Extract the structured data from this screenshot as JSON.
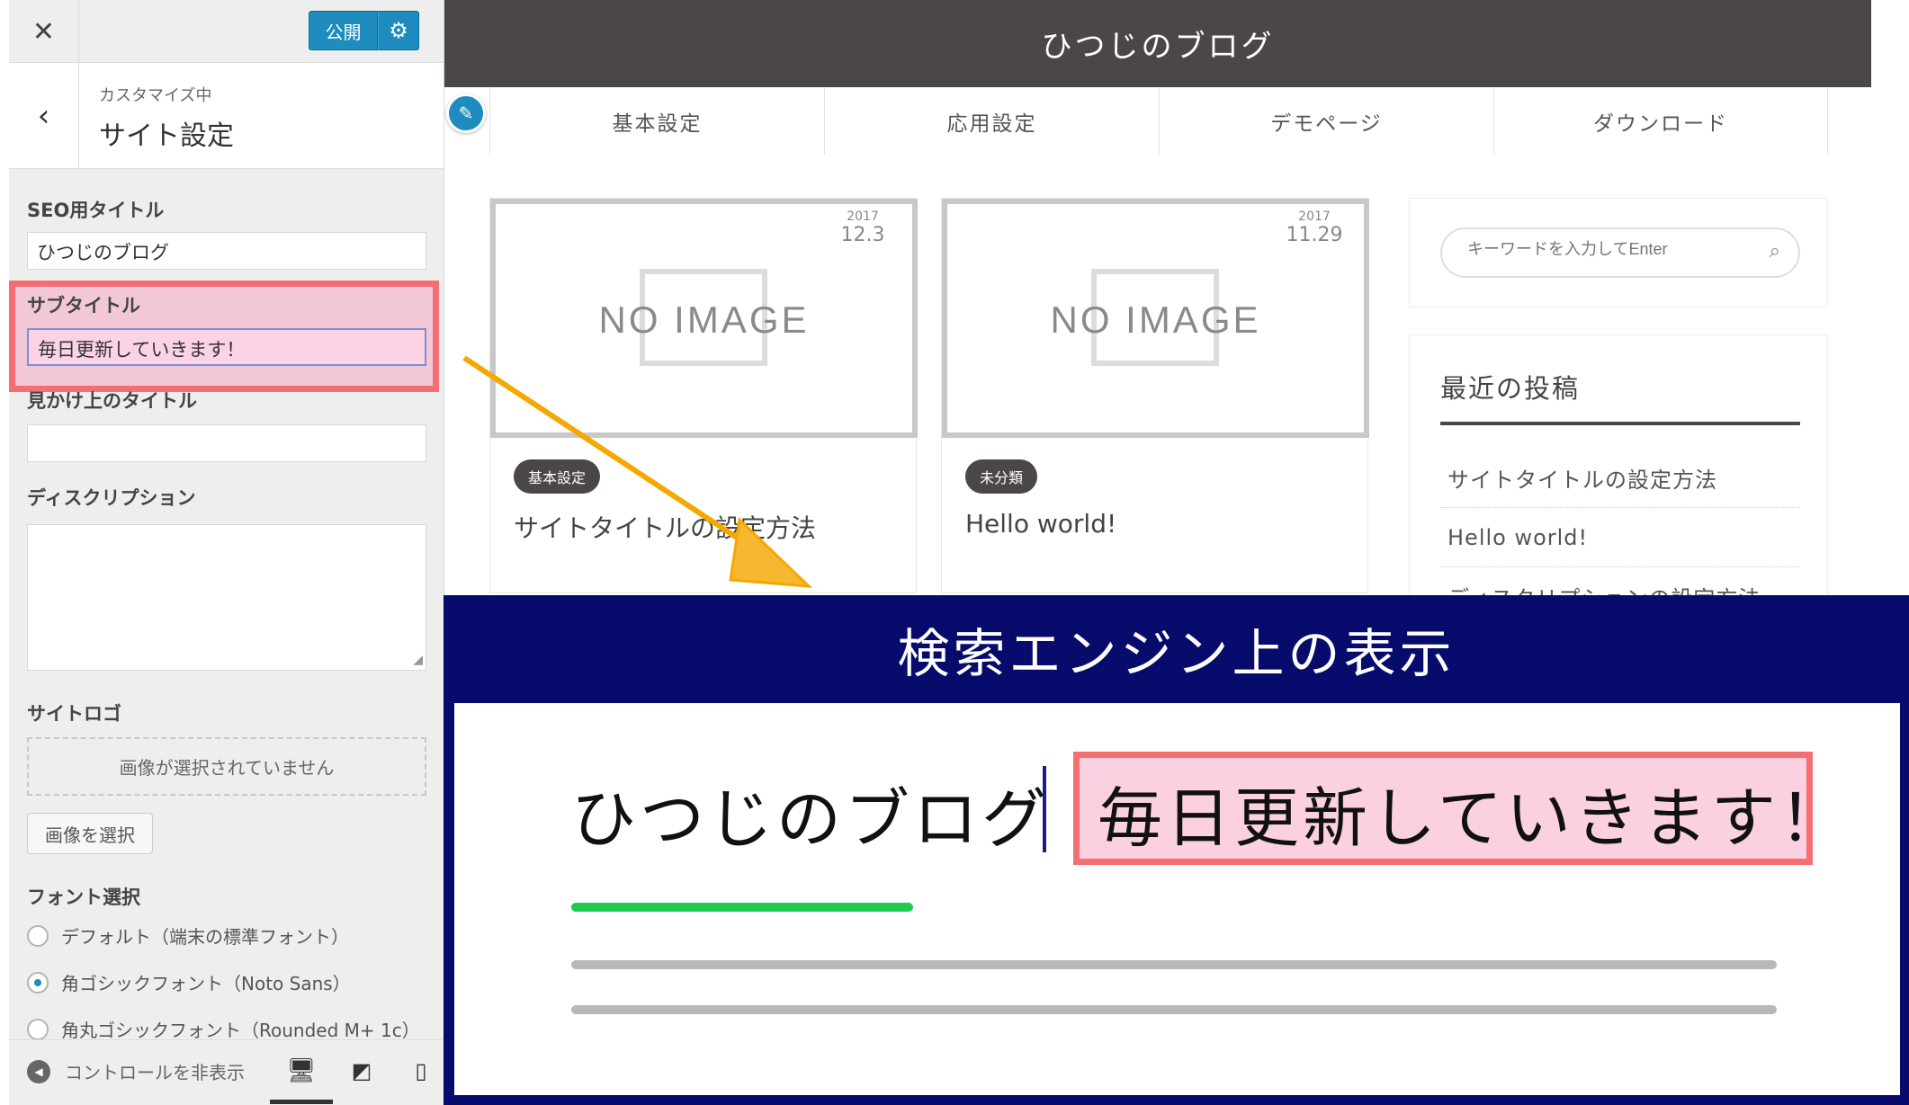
{
  "customizer": {
    "close_icon": "close-icon",
    "publish_label": "公開",
    "gear_icon": "gear-icon",
    "breadcrumb": "カスタマイズ中",
    "section_title": "サイト設定",
    "seo_title_label": "SEO用タイトル",
    "seo_title_value": "ひつじのブログ",
    "subtitle_label": "サブタイトル",
    "subtitle_value": "毎日更新していきます！",
    "apparent_title_label": "見かけ上のタイトル",
    "apparent_title_value": "",
    "description_label": "ディスクリプション",
    "description_value": "",
    "site_logo_label": "サイトロゴ",
    "no_image_selected": "画像が選択されていません",
    "select_image_button": "画像を選択",
    "font_label": "フォント選択",
    "font_options": [
      {
        "label": "デフォルト（端末の標準フォント）",
        "selected": false
      },
      {
        "label": "角ゴシックフォント（Noto Sans）",
        "selected": true
      },
      {
        "label": "角丸ゴシックフォント（Rounded M+ 1c）",
        "selected": false
      }
    ],
    "hide_controls_label": "コントロールを非表示",
    "devices": [
      "desktop",
      "tablet",
      "mobile"
    ],
    "active_device": "desktop",
    "accent_color": "#1e8cbe",
    "highlight_color": "#f47070"
  },
  "preview": {
    "site_title": "ひつじのブログ",
    "nav": [
      "基本設定",
      "応用設定",
      "デモページ",
      "ダウンロード"
    ],
    "posts": [
      {
        "year": "2017",
        "date": "12.3",
        "image_text": "NO IMAGE",
        "category": "基本設定",
        "title": "サイトタイトルの設定方法"
      },
      {
        "year": "2017",
        "date": "11.29",
        "image_text": "NO IMAGE",
        "category": "未分類",
        "title": "Hello world!"
      }
    ],
    "search_placeholder": "キーワードを入力してEnter",
    "recent_title": "最近の投稿",
    "recent_posts": [
      "サイトタイトルの設定方法",
      "Hello world!",
      "ディスクリプションの設定方法"
    ],
    "header_color": "#4b4746"
  },
  "serp": {
    "heading": "検索エンジン上の表示",
    "site_title": "ひつじのブログ",
    "subtitle": "毎日更新していきます！",
    "bg_color": "#070b6b",
    "url_color": "#1ecb4d"
  }
}
